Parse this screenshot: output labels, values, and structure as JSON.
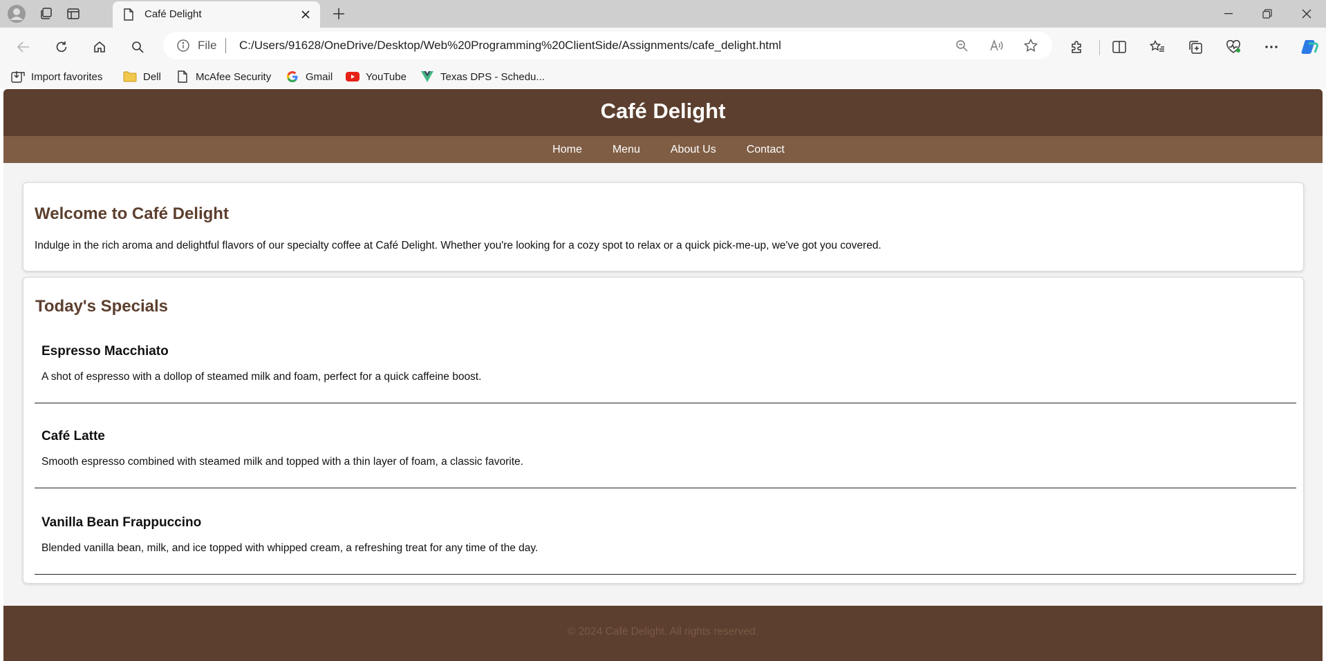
{
  "browser": {
    "tab_title": "Café Delight",
    "url_scheme": "File",
    "url": "C:/Users/91628/OneDrive/Desktop/Web%20Programming%20ClientSide/Assignments/cafe_delight.html",
    "bookmarks": [
      {
        "label": "Import favorites",
        "icon": "import-icon"
      },
      {
        "label": "Dell",
        "icon": "folder-icon"
      },
      {
        "label": "McAfee Security",
        "icon": "page-icon"
      },
      {
        "label": "Gmail",
        "icon": "google-icon"
      },
      {
        "label": "YouTube",
        "icon": "youtube-icon"
      },
      {
        "label": "Texas DPS - Schedu...",
        "icon": "vue-icon"
      }
    ]
  },
  "site": {
    "title": "Café Delight",
    "nav": [
      "Home",
      "Menu",
      "About Us",
      "Contact"
    ],
    "welcome": {
      "heading": "Welcome to Café Delight",
      "text": "Indulge in the rich aroma and delightful flavors of our specialty coffee at Café Delight. Whether you're looking for a cozy spot to relax or a quick pick-me-up, we've got you covered."
    },
    "specials": {
      "heading": "Today's Specials",
      "items": [
        {
          "name": "Espresso Macchiato",
          "description": "A shot of espresso with a dollop of steamed milk and foam, perfect for a quick caffeine boost."
        },
        {
          "name": "Café Latte",
          "description": "Smooth espresso combined with steamed milk and topped with a thin layer of foam, a classic favorite."
        },
        {
          "name": "Vanilla Bean Frappuccino",
          "description": "Blended vanilla bean, milk, and ice topped with whipped cream, a refreshing treat for any time of the day."
        }
      ]
    },
    "footer": "© 2024 Café Delight. All rights reserved."
  },
  "colors": {
    "header": "#5c3f2e",
    "nav": "#7f5d44",
    "heading": "#5c3f2e",
    "footer_text": "#7a5a46"
  }
}
